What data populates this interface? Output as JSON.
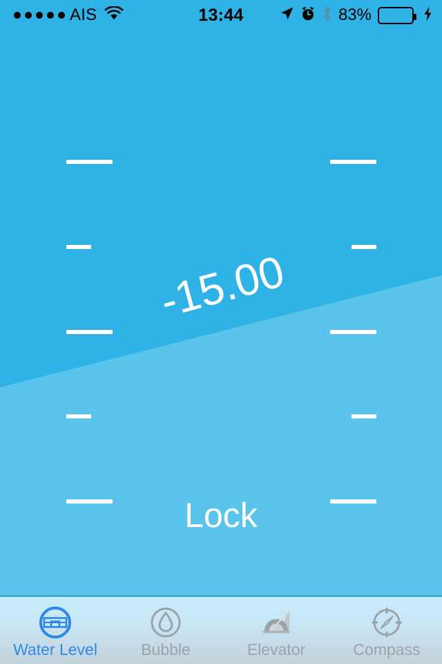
{
  "status_bar": {
    "signal_dots": 5,
    "carrier": "AIS",
    "wifi_icon": "wifi-icon",
    "time": "13:44",
    "location_icon": "location-arrow-icon",
    "alarm_icon": "alarm-clock-icon",
    "bluetooth_icon": "bluetooth-icon",
    "battery_percent": "83%",
    "battery_level": 83,
    "battery_color": "#4CD964",
    "charging_icon": "lightning-bolt-icon"
  },
  "level_view": {
    "angle_value": "-15.00",
    "angle_degrees": -15,
    "lock_label": "Lock",
    "sky_color": "#2FB3E6",
    "water_color": "#5BC4EC",
    "tick_color": "#FFFFFF",
    "ticks": [
      {
        "position": "t1",
        "size": "long"
      },
      {
        "position": "t2",
        "size": "short"
      },
      {
        "position": "t3",
        "size": "long"
      },
      {
        "position": "t4",
        "size": "short"
      },
      {
        "position": "t5",
        "size": "long"
      }
    ]
  },
  "tab_bar": {
    "active_color": "#2C89E8",
    "inactive_color": "#9AA3A8",
    "items": [
      {
        "label": "Water Level",
        "icon": "water-level-icon",
        "active": true
      },
      {
        "label": "Bubble",
        "icon": "droplet-icon",
        "active": false
      },
      {
        "label": "Elevator",
        "icon": "protractor-icon",
        "active": false
      },
      {
        "label": "Compass",
        "icon": "compass-icon",
        "active": false
      }
    ]
  }
}
